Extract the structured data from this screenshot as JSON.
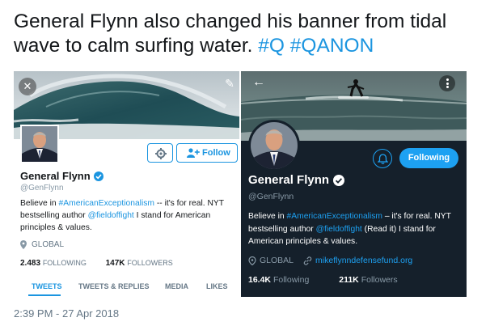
{
  "tweet": {
    "text_main": "General Flynn also changed his banner from tidal wave to calm surfing water. ",
    "hashtag_1": "#Q",
    "hashtag_2": "#QANON",
    "timestamp": "2:39 PM - 27 Apr 2018"
  },
  "left_profile": {
    "follow_label": "Follow",
    "name": "General Flynn",
    "handle": "@GenFlynn",
    "bio_part1": "Believe in ",
    "bio_link1": "#AmericanExceptionalism",
    "bio_part2": " -- it's for real. NYT bestselling author ",
    "bio_link2": "@fieldoffight",
    "bio_part3": " I stand for American principles & values.",
    "location": "GLOBAL",
    "following_count": "2.483",
    "following_label": "FOLLOWING",
    "followers_count": "147K",
    "followers_label": "FOLLOWERS",
    "tabs": [
      "TWEETS",
      "TWEETS & REPLIES",
      "MEDIA",
      "LIKES"
    ],
    "banner_icon": "tidal-wave",
    "accent": "#1b95e0"
  },
  "right_profile": {
    "following_label": "Following",
    "name": "General Flynn",
    "handle": "@GenFlynn",
    "bio_part1": "Believe in ",
    "bio_link1": "#AmericanExceptionalism",
    "bio_part2": " – it's for real. NYT bestselling author ",
    "bio_link2": "@fieldoffight",
    "bio_part3": " (Read it) I stand for American principles & values.",
    "location": "GLOBAL",
    "website": "mikeflynndefensefund.org",
    "following_count": "16.4K",
    "following_stat_label": "Following",
    "followers_count": "211K",
    "followers_stat_label": "Followers",
    "banner_icon": "surfer",
    "background": "#15202b",
    "accent": "#1da1f2"
  }
}
